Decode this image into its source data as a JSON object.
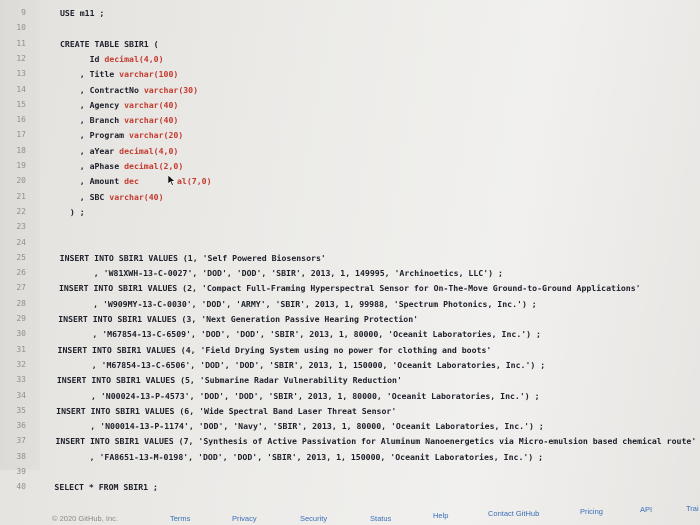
{
  "editor": {
    "lines": [
      {
        "n": "9",
        "code": "USE m11 ;"
      },
      {
        "n": "10",
        "code": ""
      },
      {
        "n": "11",
        "code": "CREATE TABLE SBIR1 ("
      },
      {
        "n": "12",
        "code": "      Id decimal(4,0)"
      },
      {
        "n": "13",
        "code": "    , Title varchar(100)"
      },
      {
        "n": "14",
        "code": "    , ContractNo varchar(30)"
      },
      {
        "n": "15",
        "code": "    , Agency varchar(40)"
      },
      {
        "n": "16",
        "code": "    , Branch varchar(40)"
      },
      {
        "n": "17",
        "code": "    , Program varchar(20)"
      },
      {
        "n": "18",
        "code": "    , aYear decimal(4,0)"
      },
      {
        "n": "19",
        "code": "    , aPhase decimal(2,0)"
      },
      {
        "n": "20",
        "code": "    , Amount dec"
      },
      {
        "n": "21",
        "code": "    , SBC varchar(40)"
      },
      {
        "n": "22",
        "code": "  ) ;"
      },
      {
        "n": "23",
        "code": ""
      },
      {
        "n": "24",
        "code": ""
      },
      {
        "n": "25",
        "code": "INSERT INTO SBIR1 VALUES (1, 'Self Powered Biosensors'"
      },
      {
        "n": "26",
        "code": "       , 'W81XWH-13-C-0027', 'DOD', 'DOD', 'SBIR', 2013, 1, 149995, 'Archinoetics, LLC') ;"
      },
      {
        "n": "27",
        "code": "INSERT INTO SBIR1 VALUES (2, 'Compact Full-Framing Hyperspectral Sensor for On-The-Move Ground-to-Ground Applications'"
      },
      {
        "n": "28",
        "code": "       , 'W909MY-13-C-0030', 'DOD', 'ARMY', 'SBIR', 2013, 1, 99988, 'Spectrum Photonics, Inc.') ;"
      },
      {
        "n": "29",
        "code": "INSERT INTO SBIR1 VALUES (3, 'Next Generation Passive Hearing Protection'"
      },
      {
        "n": "30",
        "code": "       , 'M67854-13-C-6509', 'DOD', 'DOD', 'SBIR', 2013, 1, 80000, 'Oceanit Laboratories, Inc.') ;"
      },
      {
        "n": "31",
        "code": "INSERT INTO SBIR1 VALUES (4, 'Field Drying System using no power for clothing and boots'"
      },
      {
        "n": "32",
        "code": "       , 'M67854-13-C-6506', 'DOD', 'DOD', 'SBIR', 2013, 1, 150000, 'Oceanit Laboratories, Inc.') ;"
      },
      {
        "n": "33",
        "code": "INSERT INTO SBIR1 VALUES (5, 'Submarine Radar Vulnerability Reduction'"
      },
      {
        "n": "34",
        "code": "       , 'N00024-13-P-4573', 'DOD', 'DOD', 'SBIR', 2013, 1, 80000, 'Oceanit Laboratories, Inc.') ;"
      },
      {
        "n": "35",
        "code": "INSERT INTO SBIR1 VALUES (6, 'Wide Spectral Band Laser Threat Sensor'"
      },
      {
        "n": "36",
        "code": "       , 'N00014-13-P-1174', 'DOD', 'Navy', 'SBIR', 2013, 1, 80000, 'Oceanit Laboratories, Inc.') ;"
      },
      {
        "n": "37",
        "code": "INSERT INTO SBIR1 VALUES (7, 'Synthesis of Active Passivation for Aluminum Nanoenergetics via Micro-emulsion based chemical route'"
      },
      {
        "n": "38",
        "code": "       , 'FA8651-13-M-0198', 'DOD', 'DOD', 'SBIR', 2013, 1, 150000, 'Oceanit Laboratories, Inc.') ;"
      },
      {
        "n": "39",
        "code": ""
      },
      {
        "n": "40",
        "code": "SELECT * FROM SBIR1 ;"
      }
    ],
    "line20_tail": "al(7,0)"
  },
  "footer": {
    "copyright": "© 2020 GitHub, Inc.",
    "terms": "Terms",
    "privacy": "Privacy",
    "security": "Security",
    "status": "Status",
    "help": "Help",
    "contact": "Contact GitHub",
    "pricing": "Pricing",
    "api": "API",
    "training": "Trai"
  }
}
